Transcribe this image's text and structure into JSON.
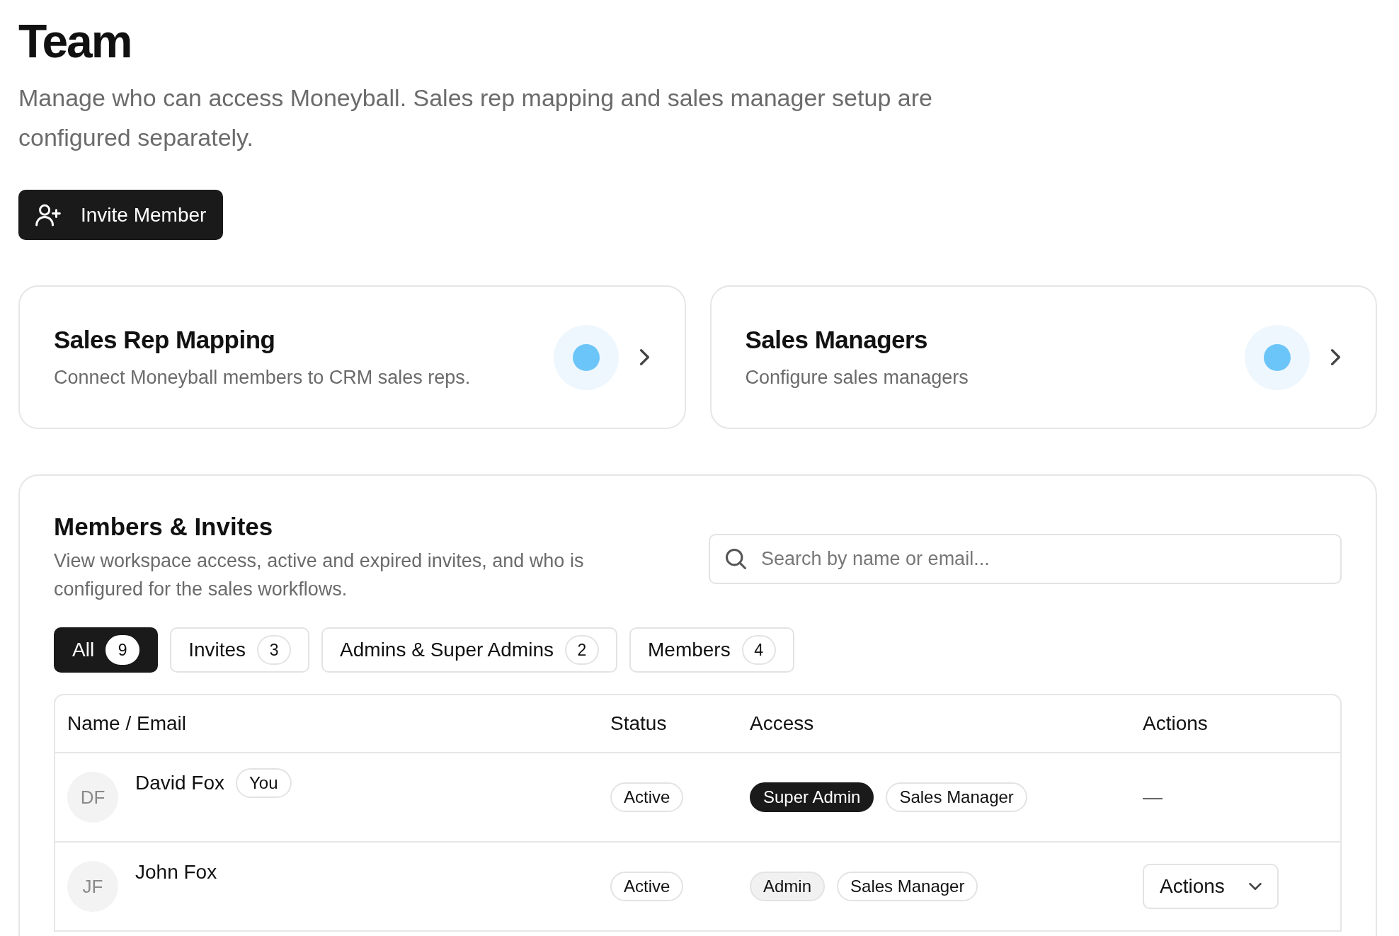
{
  "page": {
    "title": "Team",
    "description": "Manage who can access Moneyball. Sales rep mapping and sales manager setup are configured separately.",
    "invite_button": "Invite Member"
  },
  "cards": [
    {
      "title": "Sales Rep Mapping",
      "description": "Connect Moneyball members to CRM sales reps."
    },
    {
      "title": "Sales Managers",
      "description": "Configure sales managers"
    }
  ],
  "members": {
    "title": "Members & Invites",
    "description": "View workspace access, active and expired invites, and who is configured for the sales workflows.",
    "search": {
      "placeholder": "Search by name or email..."
    },
    "tabs": [
      {
        "label": "All",
        "count": "9",
        "selected": true
      },
      {
        "label": "Invites",
        "count": "3",
        "selected": false
      },
      {
        "label": "Admins & Super Admins",
        "count": "2",
        "selected": false
      },
      {
        "label": "Members",
        "count": "4",
        "selected": false
      }
    ],
    "table": {
      "columns": [
        "Name / Email",
        "Status",
        "Access",
        "Actions"
      ],
      "rows": [
        {
          "initials": "DF",
          "name": "David Fox",
          "badge": "You",
          "status": "Active",
          "access": [
            {
              "label": "Super Admin",
              "kind": "dark"
            },
            {
              "label": "Sales Manager",
              "kind": "outline"
            }
          ],
          "actions": {
            "kind": "dash",
            "label": "—"
          }
        },
        {
          "initials": "JF",
          "name": "John Fox",
          "status": "Active",
          "access": [
            {
              "label": "Admin",
              "kind": "filled"
            },
            {
              "label": "Sales Manager",
              "kind": "outline"
            }
          ],
          "actions": {
            "kind": "menu",
            "label": "Actions"
          }
        }
      ]
    }
  }
}
